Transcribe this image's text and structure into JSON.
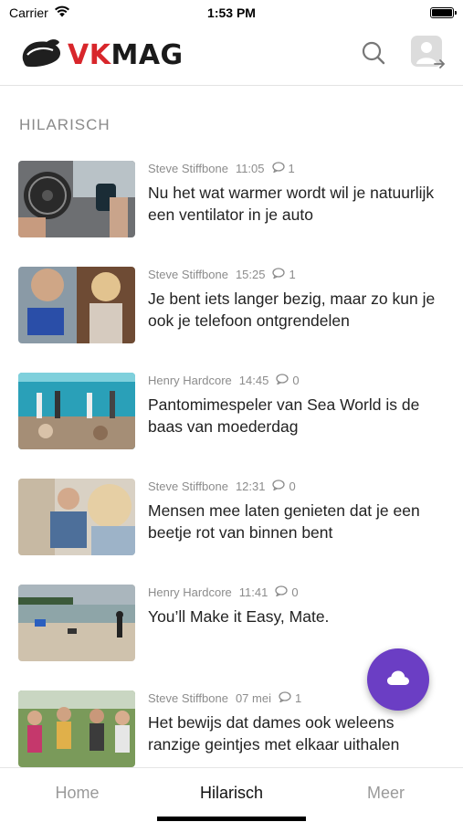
{
  "status_bar": {
    "carrier": "Carrier",
    "time": "1:53 PM"
  },
  "header": {
    "logo_vk": "VK",
    "logo_mag": "MAG",
    "brand_colors": {
      "vk": "#d8262b",
      "mag": "#1a1a1a"
    },
    "search_icon": "search-icon",
    "profile_icon": "user-login-icon"
  },
  "section": {
    "title": "HILARISCH"
  },
  "articles": [
    {
      "author": "Steve Stiffbone",
      "time": "11:05",
      "comments": "1",
      "title": "Nu het wat warmer wordt wil je natuurlijk een ventilator in je auto"
    },
    {
      "author": "Steve Stiffbone",
      "time": "15:25",
      "comments": "1",
      "title": "Je bent iets langer bezig, maar zo kun je ook je telefoon ontgrendelen"
    },
    {
      "author": "Henry Hardcore",
      "time": "14:45",
      "comments": "0",
      "title": "Pantomimespeler van Sea World is de baas van moederdag"
    },
    {
      "author": "Steve Stiffbone",
      "time": "12:31",
      "comments": "0",
      "title": "Mensen mee laten genieten dat je een beetje rot van binnen bent"
    },
    {
      "author": "Henry Hardcore",
      "time": "11:41",
      "comments": "0",
      "title": "You’ll Make it Easy, Mate."
    },
    {
      "author": "Steve Stiffbone",
      "time": "07 mei",
      "comments": "1",
      "title": "Het bewijs dat dames ook weleens ranzige geintjes met elkaar uithalen"
    }
  ],
  "fab": {
    "icon": "cloud-icon",
    "color": "#6b3ec4"
  },
  "tabs": [
    {
      "label": "Home"
    },
    {
      "label": "Hilarisch"
    },
    {
      "label": "Meer"
    }
  ]
}
